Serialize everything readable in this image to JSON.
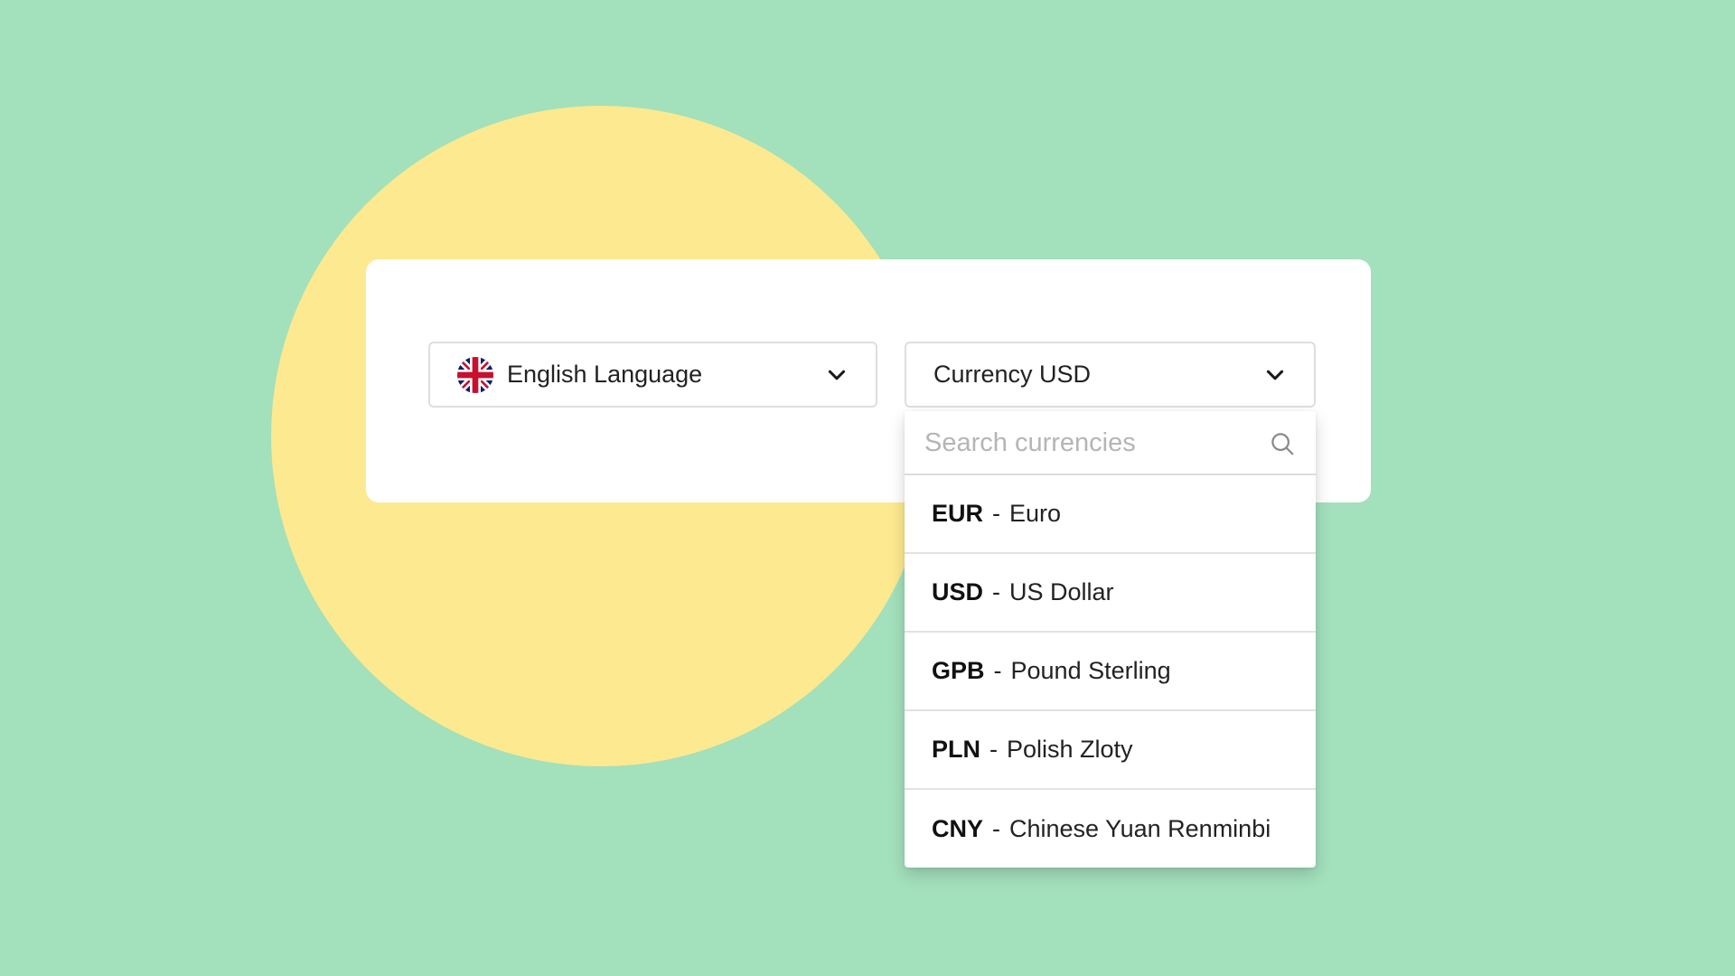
{
  "language_select": {
    "label": "English Language",
    "flag_icon": "uk-flag-icon",
    "chevron_icon": "chevron-down-icon"
  },
  "currency_select": {
    "label": "Currency USD",
    "chevron_icon": "chevron-down-icon"
  },
  "currency_dropdown": {
    "search_placeholder": "Search currencies",
    "search_value": "",
    "search_icon": "search-icon",
    "separator": "-",
    "options": [
      {
        "code": "EUR",
        "name": "Euro"
      },
      {
        "code": "USD",
        "name": "US Dollar"
      },
      {
        "code": "GPB",
        "name": "Pound Sterling"
      },
      {
        "code": "PLN",
        "name": "Polish Zloty"
      },
      {
        "code": "CNY",
        "name": "Chinese Yuan Renminbi"
      }
    ]
  },
  "colors": {
    "background": "#a3e0bc",
    "circle": "#fde98f",
    "card": "#ffffff",
    "border": "#dedede"
  }
}
